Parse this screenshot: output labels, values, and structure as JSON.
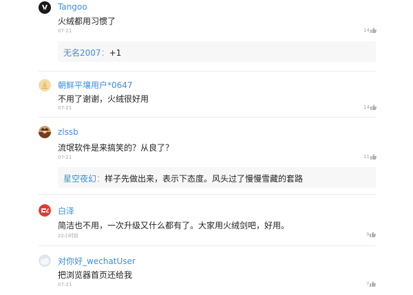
{
  "comments": [
    {
      "user": "Tangoo",
      "text": "火绒都用习惯了",
      "time": "07-21",
      "likes": "14",
      "reply": {
        "user": "无名2007",
        "sep": "：",
        "text": "+1"
      }
    },
    {
      "user": "朝鲜平壤用户*0647",
      "text": "不用了谢谢，火绒很好用",
      "time": "07-21",
      "likes": "14"
    },
    {
      "user": "zlssb",
      "text": "流氓软件是来搞笑的？从良了？",
      "time": "07-21",
      "likes": "11",
      "reply": {
        "user": "星空夜幻",
        "sep": "：",
        "text": "样子先做出来，表示下态度。风头过了慢慢雪藏的套路"
      }
    },
    {
      "user": "白泽",
      "text": "简洁也不用，一次升级又什么都有了。大家用火绒剑吧，好用。",
      "time": "22小时前",
      "likes": "9"
    },
    {
      "user": "对你好_wechatUser",
      "text": "把浏览器首页还给我",
      "time": "07-21",
      "likes": "7"
    }
  ],
  "colors": {
    "accent": "#3a8ee6",
    "muted": "#a6a6a6",
    "reply_bg": "#f7f7f7"
  }
}
